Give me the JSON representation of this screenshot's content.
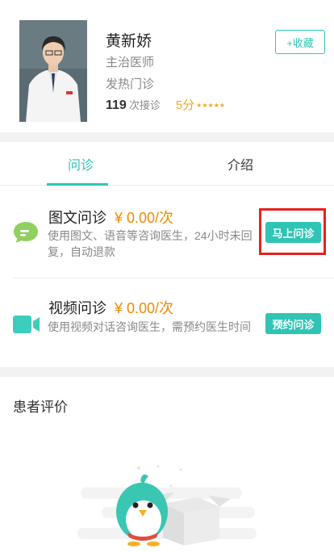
{
  "doctor": {
    "name": "黄新娇",
    "title": "主治医师",
    "department": "发热门诊",
    "consult_count": "119",
    "consult_label": "次接诊",
    "score": "5分",
    "stars": "★★★★★",
    "favorite_label": "+收藏"
  },
  "tabs": [
    {
      "label": "问诊",
      "active": true
    },
    {
      "label": "介绍",
      "active": false
    }
  ],
  "services": [
    {
      "name": "图文问诊",
      "price": "¥ 0.00/次",
      "desc": "使用图文、语音等咨询医生，24小时未回复，自动退款",
      "button": "马上问诊",
      "icon": "chat-bubble-icon"
    },
    {
      "name": "视频问诊",
      "price": "¥ 0.00/次",
      "desc": "使用视频对话咨询医生，需预约医生时间",
      "button": "预约问诊",
      "icon": "video-camera-icon"
    }
  ],
  "reviews": {
    "title": "患者评价"
  },
  "colors": {
    "accent": "#2fc4b4",
    "price": "#f08a00",
    "star": "#f5a623",
    "highlight": "#e8201e"
  }
}
